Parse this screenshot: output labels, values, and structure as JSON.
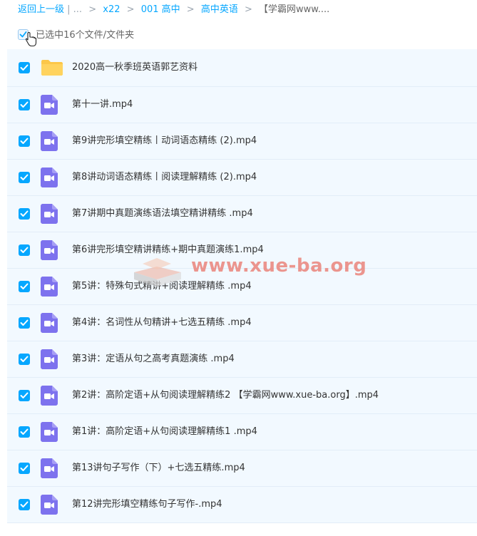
{
  "breadcrumb": {
    "back": "返回上一级",
    "ellipsis": "...",
    "items": [
      "x22",
      "001 高中",
      "高中英语"
    ],
    "current": "【学霸网www...."
  },
  "selection": {
    "text": "已选中16个文件/文件夹"
  },
  "files": [
    {
      "name": "2020高一秋季班英语郭艺资料",
      "type": "folder"
    },
    {
      "name": "第十一讲.mp4",
      "type": "video"
    },
    {
      "name": "第9讲完形填空精练丨动词语态精练 (2).mp4",
      "type": "video"
    },
    {
      "name": "第8讲动词语态精练丨阅读理解精练 (2).mp4",
      "type": "video"
    },
    {
      "name": "第7讲期中真题演练语法填空精讲精练 .mp4",
      "type": "video"
    },
    {
      "name": "第6讲完形填空精讲精练+期中真题演练1.mp4",
      "type": "video"
    },
    {
      "name": "第5讲：特殊句式精讲+阅读理解精练 .mp4",
      "type": "video"
    },
    {
      "name": "第4讲：名词性从句精讲+七选五精练 .mp4",
      "type": "video"
    },
    {
      "name": "第3讲：定语从句之高考真题演练 .mp4",
      "type": "video"
    },
    {
      "name": "第2讲：高阶定语+从句阅读理解精练2 【学霸网www.xue-ba.org】.mp4",
      "type": "video"
    },
    {
      "name": "第1讲：高阶定语+从句阅读理解精练1 .mp4",
      "type": "video"
    },
    {
      "name": "第13讲句子写作（下）+七选五精练.mp4",
      "type": "video"
    },
    {
      "name": "第12讲完形填空精练句子写作-.mp4",
      "type": "video"
    }
  ],
  "watermark": {
    "text": "www.xue-ba.org"
  },
  "colors": {
    "accent": "#06a7ff",
    "video": "#7d72ee",
    "folder": "#fcc749",
    "row_bg": "#f2f9ff"
  }
}
